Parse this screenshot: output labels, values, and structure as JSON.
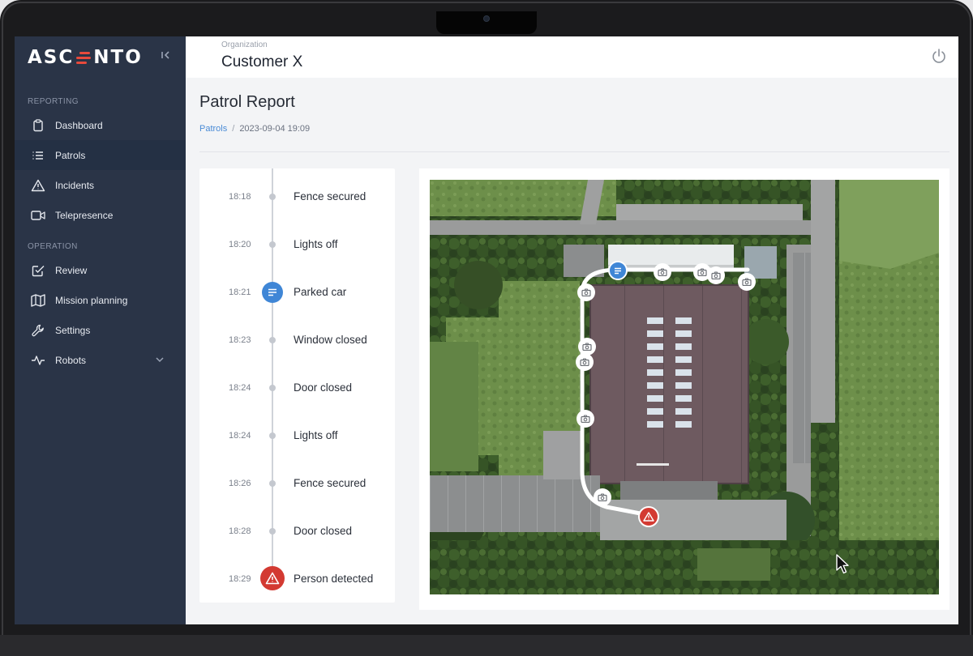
{
  "app": {
    "logo_text_left": "ASC",
    "logo_text_right": "NTO",
    "collapse_icon": "collapse-left-icon"
  },
  "sidebar": {
    "sections": [
      {
        "title": "REPORTING",
        "items": [
          {
            "label": "Dashboard",
            "icon": "clipboard-icon",
            "active": false
          },
          {
            "label": "Patrols",
            "icon": "list-icon",
            "active": true
          },
          {
            "label": "Incidents",
            "icon": "warning-icon",
            "active": false
          },
          {
            "label": "Telepresence",
            "icon": "video-icon",
            "active": false
          }
        ]
      },
      {
        "title": "OPERATION",
        "items": [
          {
            "label": "Review",
            "icon": "checkbox-edit-icon",
            "active": false
          },
          {
            "label": "Mission planning",
            "icon": "map-icon",
            "active": false
          },
          {
            "label": "Settings",
            "icon": "wrench-icon",
            "active": false
          },
          {
            "label": "Robots",
            "icon": "activity-icon",
            "active": false,
            "expandable": true
          }
        ]
      }
    ]
  },
  "header": {
    "org_label": "Organization",
    "org_name": "Customer X",
    "power_icon": "power-icon"
  },
  "page": {
    "title": "Patrol Report",
    "breadcrumb": {
      "parent": "Patrols",
      "separator": "/",
      "current": "2023-09-04 19:09"
    }
  },
  "timeline": [
    {
      "time": "18:18",
      "label": "Fence secured",
      "kind": "dot"
    },
    {
      "time": "18:20",
      "label": "Lights off",
      "kind": "dot"
    },
    {
      "time": "18:21",
      "label": "Parked car",
      "kind": "note"
    },
    {
      "time": "18:23",
      "label": "Window closed",
      "kind": "dot"
    },
    {
      "time": "18:24",
      "label": "Door closed",
      "kind": "dot"
    },
    {
      "time": "18:24",
      "label": "Lights off",
      "kind": "dot"
    },
    {
      "time": "18:26",
      "label": "Fence secured",
      "kind": "dot"
    },
    {
      "time": "18:28",
      "label": "Door closed",
      "kind": "dot"
    },
    {
      "time": "18:29",
      "label": "Person detected",
      "kind": "alert"
    }
  ],
  "colors": {
    "sidebar_bg": "#2a3447",
    "accent_blue": "#3f86d6",
    "alert_red": "#d33a32",
    "logo_red": "#e84a3c"
  },
  "map": {
    "markers": [
      "note-marker-icon",
      "camera-marker-icon",
      "alert-marker-icon"
    ]
  }
}
